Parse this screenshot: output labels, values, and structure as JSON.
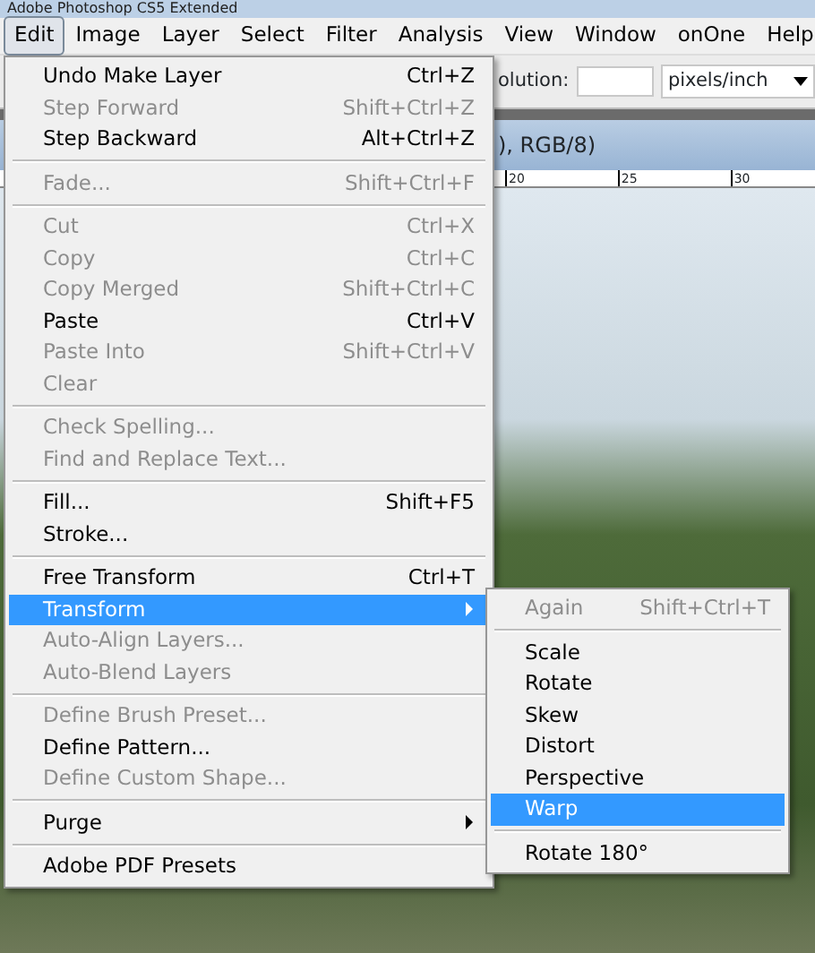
{
  "window": {
    "title": "Adobe Photoshop CS5 Extended"
  },
  "menubar": [
    {
      "label": "Edit",
      "selected": true
    },
    {
      "label": "Image",
      "selected": false
    },
    {
      "label": "Layer",
      "selected": false
    },
    {
      "label": "Select",
      "selected": false
    },
    {
      "label": "Filter",
      "selected": false
    },
    {
      "label": "Analysis",
      "selected": false
    },
    {
      "label": "View",
      "selected": false
    },
    {
      "label": "Window",
      "selected": false
    },
    {
      "label": "onOne",
      "selected": false
    },
    {
      "label": "Help",
      "selected": false
    }
  ],
  "options_bar": {
    "resolution_label": "olution:",
    "units_select": {
      "value": "pixels/inch"
    }
  },
  "document": {
    "tab_title": "), RGB/8)",
    "ruler_labels": [
      "20",
      "25",
      "30"
    ]
  },
  "edit_menu": [
    {
      "kind": "item",
      "label": "Undo Make Layer",
      "shortcut": "Ctrl+Z",
      "disabled": false,
      "selected": false,
      "has_submenu": false
    },
    {
      "kind": "item",
      "label": "Step Forward",
      "shortcut": "Shift+Ctrl+Z",
      "disabled": true,
      "selected": false,
      "has_submenu": false
    },
    {
      "kind": "item",
      "label": "Step Backward",
      "shortcut": "Alt+Ctrl+Z",
      "disabled": false,
      "selected": false,
      "has_submenu": false
    },
    {
      "kind": "separator"
    },
    {
      "kind": "item",
      "label": "Fade...",
      "shortcut": "Shift+Ctrl+F",
      "disabled": true,
      "selected": false,
      "has_submenu": false
    },
    {
      "kind": "separator"
    },
    {
      "kind": "item",
      "label": "Cut",
      "shortcut": "Ctrl+X",
      "disabled": true,
      "selected": false,
      "has_submenu": false
    },
    {
      "kind": "item",
      "label": "Copy",
      "shortcut": "Ctrl+C",
      "disabled": true,
      "selected": false,
      "has_submenu": false
    },
    {
      "kind": "item",
      "label": "Copy Merged",
      "shortcut": "Shift+Ctrl+C",
      "disabled": true,
      "selected": false,
      "has_submenu": false
    },
    {
      "kind": "item",
      "label": "Paste",
      "shortcut": "Ctrl+V",
      "disabled": false,
      "selected": false,
      "has_submenu": false
    },
    {
      "kind": "item",
      "label": "Paste Into",
      "shortcut": "Shift+Ctrl+V",
      "disabled": true,
      "selected": false,
      "has_submenu": false
    },
    {
      "kind": "item",
      "label": "Clear",
      "disabled": true,
      "selected": false,
      "has_submenu": false
    },
    {
      "kind": "separator"
    },
    {
      "kind": "item",
      "label": "Check Spelling...",
      "disabled": true,
      "selected": false,
      "has_submenu": false
    },
    {
      "kind": "item",
      "label": "Find and Replace Text...",
      "disabled": true,
      "selected": false,
      "has_submenu": false
    },
    {
      "kind": "separator"
    },
    {
      "kind": "item",
      "label": "Fill...",
      "shortcut": "Shift+F5",
      "disabled": false,
      "selected": false,
      "has_submenu": false
    },
    {
      "kind": "item",
      "label": "Stroke...",
      "disabled": false,
      "selected": false,
      "has_submenu": false
    },
    {
      "kind": "separator"
    },
    {
      "kind": "item",
      "label": "Free Transform",
      "shortcut": "Ctrl+T",
      "disabled": false,
      "selected": false,
      "has_submenu": false
    },
    {
      "kind": "item",
      "label": "Transform",
      "disabled": false,
      "selected": true,
      "has_submenu": true
    },
    {
      "kind": "item",
      "label": "Auto-Align Layers...",
      "disabled": true,
      "selected": false,
      "has_submenu": false
    },
    {
      "kind": "item",
      "label": "Auto-Blend Layers",
      "disabled": true,
      "selected": false,
      "has_submenu": false
    },
    {
      "kind": "separator"
    },
    {
      "kind": "item",
      "label": "Define Brush Preset...",
      "disabled": true,
      "selected": false,
      "has_submenu": false
    },
    {
      "kind": "item",
      "label": "Define Pattern...",
      "disabled": false,
      "selected": false,
      "has_submenu": false
    },
    {
      "kind": "item",
      "label": "Define Custom Shape...",
      "disabled": true,
      "selected": false,
      "has_submenu": false
    },
    {
      "kind": "separator"
    },
    {
      "kind": "item",
      "label": "Purge",
      "disabled": false,
      "selected": false,
      "has_submenu": true
    },
    {
      "kind": "separator"
    },
    {
      "kind": "item",
      "label": "Adobe PDF Presets",
      "disabled": false,
      "selected": false,
      "has_submenu": false
    }
  ],
  "transform_submenu": [
    {
      "kind": "item",
      "label": "Again",
      "shortcut": "Shift+Ctrl+T",
      "disabled": true,
      "selected": false,
      "has_submenu": false
    },
    {
      "kind": "separator"
    },
    {
      "kind": "item",
      "label": "Scale",
      "disabled": false,
      "selected": false,
      "has_submenu": false
    },
    {
      "kind": "item",
      "label": "Rotate",
      "disabled": false,
      "selected": false,
      "has_submenu": false
    },
    {
      "kind": "item",
      "label": "Skew",
      "disabled": false,
      "selected": false,
      "has_submenu": false
    },
    {
      "kind": "item",
      "label": "Distort",
      "disabled": false,
      "selected": false,
      "has_submenu": false
    },
    {
      "kind": "item",
      "label": "Perspective",
      "disabled": false,
      "selected": false,
      "has_submenu": false
    },
    {
      "kind": "item",
      "label": "Warp",
      "disabled": false,
      "selected": true,
      "has_submenu": false
    },
    {
      "kind": "separator"
    },
    {
      "kind": "item",
      "label": "Rotate 180°",
      "disabled": false,
      "selected": false,
      "has_submenu": false
    }
  ]
}
